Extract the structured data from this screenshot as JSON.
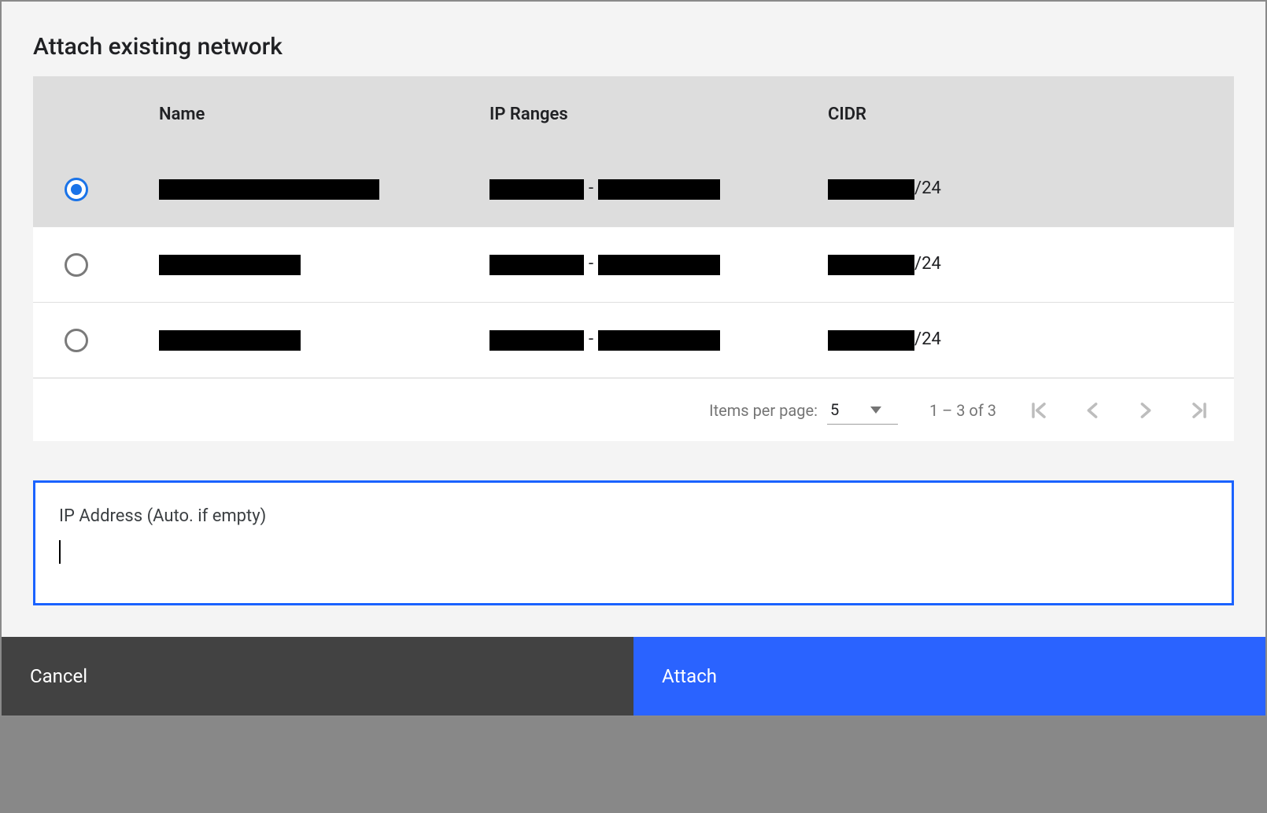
{
  "dialog": {
    "title": "Attach existing network"
  },
  "table": {
    "headers": {
      "name": "Name",
      "ip_ranges": "IP Ranges",
      "cidr": "CIDR"
    },
    "rows": [
      {
        "selected": true,
        "cidr_suffix": "/24"
      },
      {
        "selected": false,
        "cidr_suffix": "/24"
      },
      {
        "selected": false,
        "cidr_suffix": "/24"
      }
    ]
  },
  "paginator": {
    "items_per_page_label": "Items per page:",
    "items_per_page_value": "5",
    "range_label": "1 – 3 of 3"
  },
  "ip_field": {
    "label": "IP Address (Auto. if empty)",
    "value": ""
  },
  "footer": {
    "cancel": "Cancel",
    "attach": "Attach"
  }
}
